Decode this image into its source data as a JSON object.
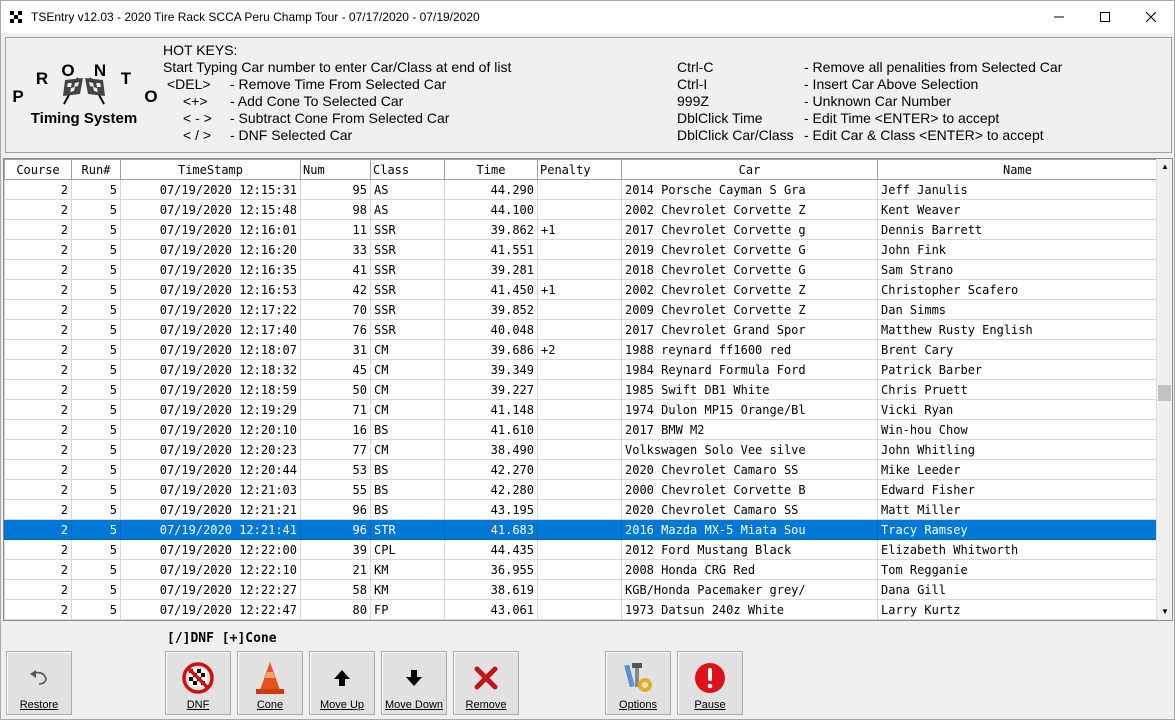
{
  "window": {
    "title": "TSEntry v12.03 - 2020 Tire Rack SCCA Peru Champ Tour - 07/17/2020 - 07/19/2020",
    "min": "—",
    "max": "☐",
    "close": "✕"
  },
  "logo": {
    "letters": [
      "P",
      "R",
      "O",
      "N",
      "T",
      "O"
    ],
    "caption": "Timing System"
  },
  "hotkeys": {
    "heading": "HOT KEYS:",
    "intro": "Start Typing Car number to enter Car/Class at end of list",
    "left": [
      {
        "key": "<DEL>",
        "desc": "- Remove Time From Selected Car"
      },
      {
        "key": "<+>",
        "desc": "- Add Cone To Selected Car"
      },
      {
        "key": "< - >",
        "desc": "- Subtract Cone From Selected Car"
      },
      {
        "key": "< / >",
        "desc": "- DNF Selected Car"
      }
    ],
    "right": [
      {
        "key": "Ctrl-C",
        "desc": "- Remove all penalities from Selected Car"
      },
      {
        "key": "Ctrl-I",
        "desc": "- Insert Car Above Selection"
      },
      {
        "key": "999Z",
        "desc": "- Unknown Car Number"
      },
      {
        "key": "DblClick Time",
        "desc": "- Edit Time <ENTER> to accept"
      },
      {
        "key": "DblClick Car/Class",
        "desc": "- Edit Car & Class <ENTER> to accept"
      }
    ]
  },
  "table": {
    "columns": [
      "Course",
      "Run#",
      "TimeStamp",
      "Num",
      "Class",
      "Time",
      "Penalty",
      "Car",
      "Name"
    ],
    "selected_index": 17,
    "rows": [
      [
        "2",
        "5",
        "07/19/2020 12:15:31",
        "95",
        "AS",
        "44.290",
        "",
        "2014 Porsche Cayman S Gra",
        "Jeff Janulis"
      ],
      [
        "2",
        "5",
        "07/19/2020 12:15:48",
        "98",
        "AS",
        "44.100",
        "",
        "2002 Chevrolet Corvette Z",
        "Kent Weaver"
      ],
      [
        "2",
        "5",
        "07/19/2020 12:16:01",
        "11",
        "SSR",
        "39.862",
        "+1",
        "2017 Chevrolet Corvette g",
        "Dennis Barrett"
      ],
      [
        "2",
        "5",
        "07/19/2020 12:16:20",
        "33",
        "SSR",
        "41.551",
        "",
        "2019 Chevrolet Corvette G",
        "John Fink"
      ],
      [
        "2",
        "5",
        "07/19/2020 12:16:35",
        "41",
        "SSR",
        "39.281",
        "",
        "2018 Chevrolet Corvette G",
        "Sam Strano"
      ],
      [
        "2",
        "5",
        "07/19/2020 12:16:53",
        "42",
        "SSR",
        "41.450",
        "+1",
        "2002 Chevrolet Corvette Z",
        "Christopher Scafero"
      ],
      [
        "2",
        "5",
        "07/19/2020 12:17:22",
        "70",
        "SSR",
        "39.852",
        "",
        "2009 Chevrolet Corvette Z",
        "Dan Simms"
      ],
      [
        "2",
        "5",
        "07/19/2020 12:17:40",
        "76",
        "SSR",
        "40.048",
        "",
        "2017 Chevrolet Grand Spor",
        "Matthew Rusty English"
      ],
      [
        "2",
        "5",
        "07/19/2020 12:18:07",
        "31",
        "CM",
        "39.686",
        "+2",
        "1988 reynard ff1600 red",
        "Brent Cary"
      ],
      [
        "2",
        "5",
        "07/19/2020 12:18:32",
        "45",
        "CM",
        "39.349",
        "",
        "1984 Reynard Formula Ford",
        "Patrick Barber"
      ],
      [
        "2",
        "5",
        "07/19/2020 12:18:59",
        "50",
        "CM",
        "39.227",
        "",
        "1985 Swift DB1 White",
        "Chris Pruett"
      ],
      [
        "2",
        "5",
        "07/19/2020 12:19:29",
        "71",
        "CM",
        "41.148",
        "",
        "1974 Dulon MP15 Orange/Bl",
        "Vicki Ryan"
      ],
      [
        "2",
        "5",
        "07/19/2020 12:20:10",
        "16",
        "BS",
        "41.610",
        "",
        "2017 BMW M2",
        "Win-hou Chow"
      ],
      [
        "2",
        "5",
        "07/19/2020 12:20:23",
        "77",
        "CM",
        "38.490",
        "",
        "Volkswagen Solo Vee silve",
        "John Whitling"
      ],
      [
        "2",
        "5",
        "07/19/2020 12:20:44",
        "53",
        "BS",
        "42.270",
        "",
        "2020 Chevrolet Camaro SS",
        "Mike Leeder"
      ],
      [
        "2",
        "5",
        "07/19/2020 12:21:03",
        "55",
        "BS",
        "42.280",
        "",
        "2000 Chevrolet Corvette B",
        "Edward Fisher"
      ],
      [
        "2",
        "5",
        "07/19/2020 12:21:21",
        "96",
        "BS",
        "43.195",
        "",
        "2020 Chevrolet Camaro SS",
        "Matt Miller"
      ],
      [
        "2",
        "5",
        "07/19/2020 12:21:41",
        "96",
        "STR",
        "41.683",
        "",
        "2016 Mazda MX-5 Miata Sou",
        "Tracy Ramsey"
      ],
      [
        "2",
        "5",
        "07/19/2020 12:22:00",
        "39",
        "CPL",
        "44.435",
        "",
        "2012 Ford Mustang Black",
        "Elizabeth Whitworth"
      ],
      [
        "2",
        "5",
        "07/19/2020 12:22:10",
        "21",
        "KM",
        "36.955",
        "",
        "2008 Honda CRG Red",
        "Tom Regganie"
      ],
      [
        "2",
        "5",
        "07/19/2020 12:22:27",
        "58",
        "KM",
        "38.619",
        "",
        "KGB/Honda Pacemaker grey/",
        "Dana Gill"
      ],
      [
        "2",
        "5",
        "07/19/2020 12:22:47",
        "80",
        "FP",
        "43.061",
        "",
        "1973 Datsun 240z White",
        "Larry Kurtz"
      ]
    ]
  },
  "toolbar": {
    "hint": "[/]DNF [+]Cone",
    "buttons": {
      "restore": "Restore",
      "dnf": "DNF",
      "cone": "Cone",
      "move_up": "Move Up",
      "move_down": "Move Down",
      "remove": "Remove",
      "options": "Options",
      "pause": "Pause"
    }
  },
  "colors": {
    "selection": "#0078d7",
    "cone": "#e8501e",
    "remove": "#c0141c",
    "pause": "#e0101a"
  }
}
